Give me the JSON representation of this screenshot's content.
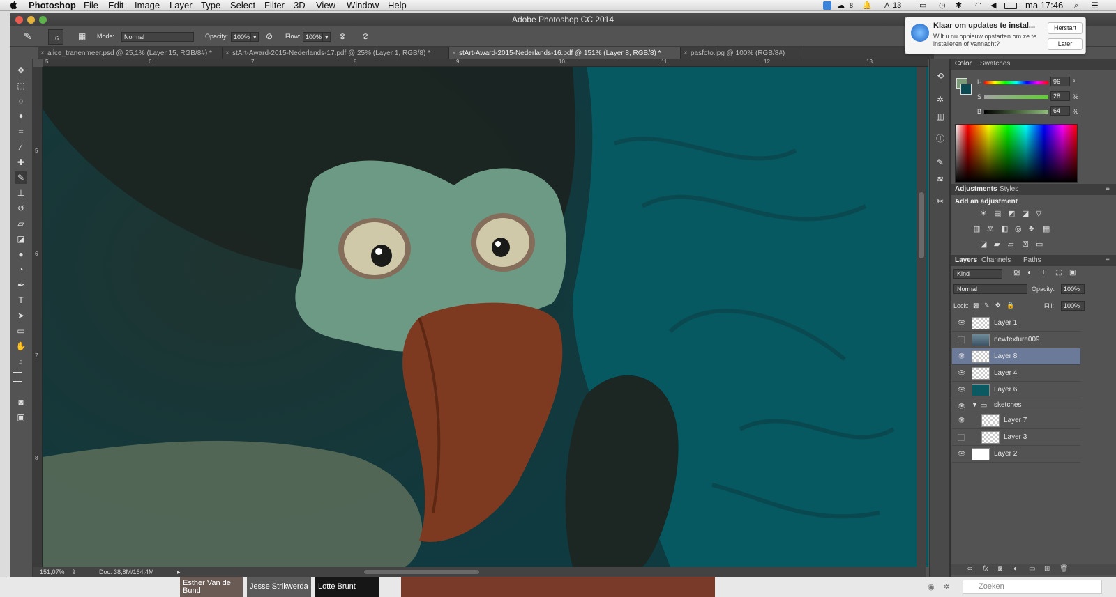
{
  "menubar": {
    "app_name": "Photoshop",
    "items": [
      "File",
      "Edit",
      "Image",
      "Layer",
      "Type",
      "Select",
      "Filter",
      "3D",
      "View",
      "Window",
      "Help"
    ],
    "status_icons": [
      "dropbox-icon",
      "cloud-icon",
      "wifi-icon",
      "battery-icon",
      "bluetooth-icon",
      "time-machine-icon",
      "display-icon"
    ],
    "badge_a": "8",
    "badge_b": "13",
    "clock": "ma 17:46",
    "search_icon": "spotlight-icon",
    "list_icon": "notification-center-icon"
  },
  "window": {
    "title": "Adobe Photoshop CC 2014"
  },
  "options_bar": {
    "brush_size": "6",
    "mode_label": "Mode:",
    "mode_value": "Normal",
    "opacity_label": "Opacity:",
    "opacity_value": "100%",
    "flow_label": "Flow:",
    "flow_value": "100%"
  },
  "doc_tabs": [
    {
      "label": "alice_tranenmeer.psd @ 25,1% (Layer 15, RGB/8#) *",
      "active": false
    },
    {
      "label": "stArt-Award-2015-Nederlands-17.pdf @ 25% (Layer 1, RGB/8) *",
      "active": false
    },
    {
      "label": "stArt-Award-2015-Nederlands-16.pdf @ 151% (Layer 8, RGB/8) *",
      "active": true
    },
    {
      "label": "pasfoto.jpg @ 100% (RGB/8#)",
      "active": false
    }
  ],
  "ruler_h": [
    "5",
    "6",
    "7",
    "8",
    "9",
    "10",
    "11",
    "12",
    "13"
  ],
  "ruler_v": [
    "5",
    "6",
    "7",
    "8"
  ],
  "status_bar": {
    "zoom": "151,07%",
    "doc_size": "Doc: 38,8M/164,4M"
  },
  "notification": {
    "title": "Klaar om updates te instal...",
    "body": "Wilt u nu opnieuw opstarten om ze te installeren of vannacht?",
    "button_primary": "Herstart",
    "button_secondary": "Later"
  },
  "color_panel": {
    "tab_color": "Color",
    "tab_swatches": "Swatches",
    "h_label": "H",
    "h_value": "96",
    "h_unit": "°",
    "s_label": "S",
    "s_value": "28",
    "s_unit": "%",
    "b_label": "B",
    "b_value": "64",
    "b_unit": "%",
    "foreground_color": "#7a9a78",
    "background_color": "#0b4a52"
  },
  "adjustments_panel": {
    "tab_adjustments": "Adjustments",
    "tab_styles": "Styles",
    "heading": "Add an adjustment"
  },
  "layers_panel": {
    "tab_layers": "Layers",
    "tab_channels": "Channels",
    "tab_paths": "Paths",
    "filter_kind": "Kind",
    "blend_mode": "Normal",
    "opacity_label": "Opacity:",
    "opacity_value": "100%",
    "lock_label": "Lock:",
    "fill_label": "Fill:",
    "fill_value": "100%",
    "layers": [
      {
        "name": "Layer 1",
        "visible": true,
        "selected": false,
        "indent": false,
        "group": false
      },
      {
        "name": "newtexture009",
        "visible": false,
        "selected": false,
        "indent": false,
        "group": false
      },
      {
        "name": "Layer 8",
        "visible": true,
        "selected": true,
        "indent": false,
        "group": false
      },
      {
        "name": "Layer 4",
        "visible": true,
        "selected": false,
        "indent": false,
        "group": false
      },
      {
        "name": "Layer 6",
        "visible": true,
        "selected": false,
        "indent": false,
        "group": false
      },
      {
        "name": "sketches",
        "visible": true,
        "selected": false,
        "indent": false,
        "group": true
      },
      {
        "name": "Layer 7",
        "visible": true,
        "selected": false,
        "indent": true,
        "group": false
      },
      {
        "name": "Layer 3",
        "visible": false,
        "selected": false,
        "indent": true,
        "group": false
      },
      {
        "name": "Layer 2",
        "visible": true,
        "selected": false,
        "indent": false,
        "group": false
      }
    ]
  },
  "taskbar": {
    "items": [
      "Esther Van de Bund",
      "Jesse Strikwerda",
      "Lotte Brunt"
    ],
    "search_placeholder": "Zoeken"
  }
}
